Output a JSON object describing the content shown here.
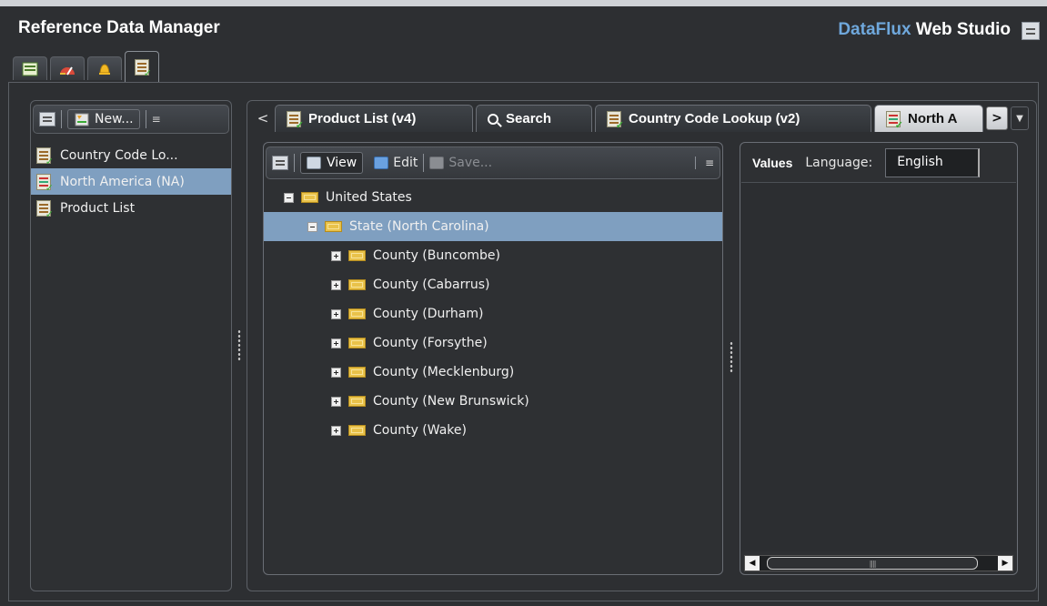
{
  "app": {
    "title": "Reference Data Manager",
    "brand_part1": "DataFlux",
    "brand_part2": "Web Studio"
  },
  "app_tabs": [
    {
      "icon": "table-icon"
    },
    {
      "icon": "dashboard-icon"
    },
    {
      "icon": "alert-bell-icon"
    },
    {
      "icon": "reference-doc-icon",
      "active": true
    }
  ],
  "left_toolbar": {
    "new_label": "New..."
  },
  "left_list": {
    "items": [
      {
        "label": "Country Code Lo...",
        "selected": false
      },
      {
        "label": "North America (NA)",
        "selected": true
      },
      {
        "label": "Product List",
        "selected": false
      }
    ]
  },
  "doc_tabs": {
    "tabs": [
      {
        "label": "Product List (v4)",
        "active": false
      },
      {
        "label": "Search",
        "active": false
      },
      {
        "label": "Country Code Lookup (v2)",
        "active": false
      },
      {
        "label": "North A",
        "active": true
      }
    ],
    "prev_glyph": "<",
    "next_glyph": ">",
    "dropdown_glyph": "▼"
  },
  "tree_toolbar": {
    "view_label": "View",
    "edit_label": "Edit",
    "save_label": "Save..."
  },
  "tree": {
    "rows": [
      {
        "label": "United States",
        "level": 0,
        "expanded": true,
        "selected": false
      },
      {
        "label": "State (North Carolina)",
        "level": 1,
        "expanded": true,
        "selected": true
      },
      {
        "label": "County (Buncombe)",
        "level": 2,
        "expanded": false,
        "selected": false
      },
      {
        "label": "County (Cabarrus)",
        "level": 2,
        "expanded": false,
        "selected": false
      },
      {
        "label": "County (Durham)",
        "level": 2,
        "expanded": false,
        "selected": false
      },
      {
        "label": "County (Forsythe)",
        "level": 2,
        "expanded": false,
        "selected": false
      },
      {
        "label": "County (Mecklenburg)",
        "level": 2,
        "expanded": false,
        "selected": false
      },
      {
        "label": "County (New Brunswick)",
        "level": 2,
        "expanded": false,
        "selected": false
      },
      {
        "label": "County (Wake)",
        "level": 2,
        "expanded": false,
        "selected": false
      }
    ]
  },
  "values_panel": {
    "values_label": "Values",
    "language_label": "Language:",
    "language_value": "English"
  },
  "colors": {
    "selection": "#7f9fc0",
    "brand_blue": "#6fa8dc",
    "background": "#2d2f32"
  }
}
